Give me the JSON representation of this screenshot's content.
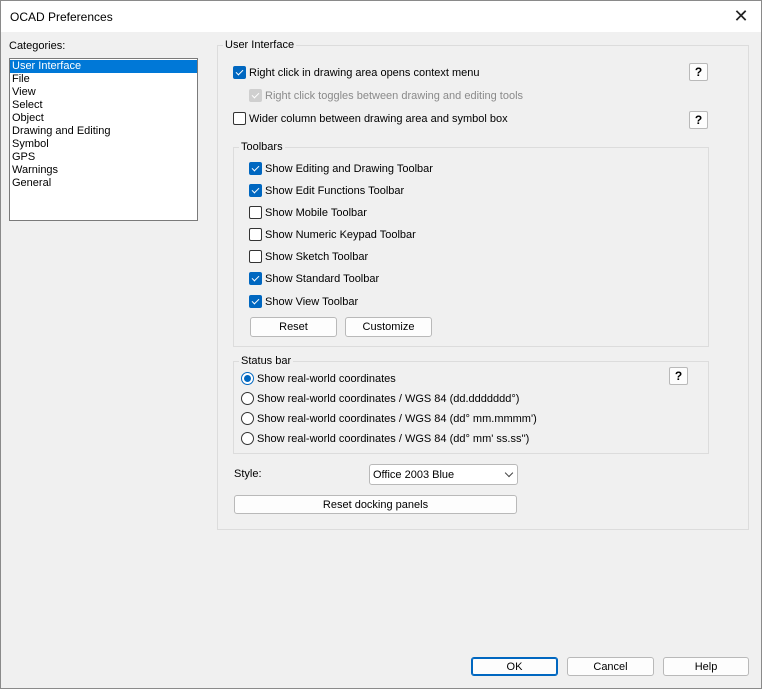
{
  "window": {
    "title": "OCAD Preferences",
    "close_glyph": "✕"
  },
  "categories": {
    "label": "Categories:",
    "items": [
      {
        "label": "User Interface",
        "selected": true
      },
      {
        "label": "File",
        "selected": false
      },
      {
        "label": "View",
        "selected": false
      },
      {
        "label": "Select",
        "selected": false
      },
      {
        "label": "Object",
        "selected": false
      },
      {
        "label": "Drawing and Editing",
        "selected": false
      },
      {
        "label": "Symbol",
        "selected": false
      },
      {
        "label": "GPS",
        "selected": false
      },
      {
        "label": "Warnings",
        "selected": false
      },
      {
        "label": "General",
        "selected": false
      }
    ]
  },
  "user_interface": {
    "title": "User Interface",
    "right_click_menu": {
      "label": "Right click in drawing area opens context menu",
      "checked": true
    },
    "right_click_toggles": {
      "label": "Right click toggles between drawing and editing tools",
      "checked": true,
      "enabled": false
    },
    "wider_column": {
      "label": "Wider column between drawing area and symbol box",
      "checked": false
    },
    "help_label": "?"
  },
  "toolbars": {
    "title": "Toolbars",
    "items": [
      {
        "label": "Show Editing and Drawing Toolbar",
        "checked": true
      },
      {
        "label": "Show Edit Functions Toolbar",
        "checked": true
      },
      {
        "label": "Show Mobile Toolbar",
        "checked": false
      },
      {
        "label": "Show Numeric Keypad Toolbar",
        "checked": false
      },
      {
        "label": "Show Sketch Toolbar",
        "checked": false
      },
      {
        "label": "Show Standard Toolbar",
        "checked": true
      },
      {
        "label": "Show View Toolbar",
        "checked": true
      }
    ],
    "reset_label": "Reset",
    "customize_label": "Customize"
  },
  "status_bar": {
    "title": "Status bar",
    "options": [
      {
        "label": "Show real-world coordinates",
        "selected": true
      },
      {
        "label": "Show real-world coordinates / WGS 84 (dd.ddddddd°)",
        "selected": false
      },
      {
        "label": "Show real-world coordinates / WGS 84 (dd° mm.mmmm')",
        "selected": false
      },
      {
        "label": "Show real-world coordinates / WGS 84 (dd° mm' ss.ss'')",
        "selected": false
      }
    ],
    "help_label": "?"
  },
  "style": {
    "label": "Style:",
    "value": "Office 2003 Blue"
  },
  "reset_docking_label": "Reset docking panels",
  "footer": {
    "ok_label": "OK",
    "cancel_label": "Cancel",
    "help_label": "Help"
  },
  "colors": {
    "accent": "#0067c0",
    "selection": "#0078d7"
  }
}
